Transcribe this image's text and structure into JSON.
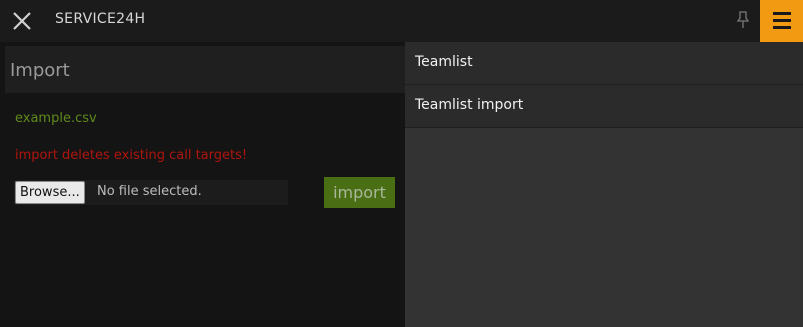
{
  "topbar": {
    "title": "SERVICE24H",
    "close_icon": "close-x-icon",
    "pin_icon": "pin-icon",
    "menu_icon": "hamburger-menu-icon",
    "menu_color": "#f29a12"
  },
  "main": {
    "panel_title": "Import",
    "example_link": "example.csv",
    "warning": "import deletes existing call targets!",
    "file_input": {
      "browse_label": "Browse...",
      "status": "No file selected."
    },
    "import_button": "import"
  },
  "sidemenu": {
    "items": [
      {
        "label": "Teamlist"
      },
      {
        "label": "Teamlist import"
      }
    ]
  }
}
